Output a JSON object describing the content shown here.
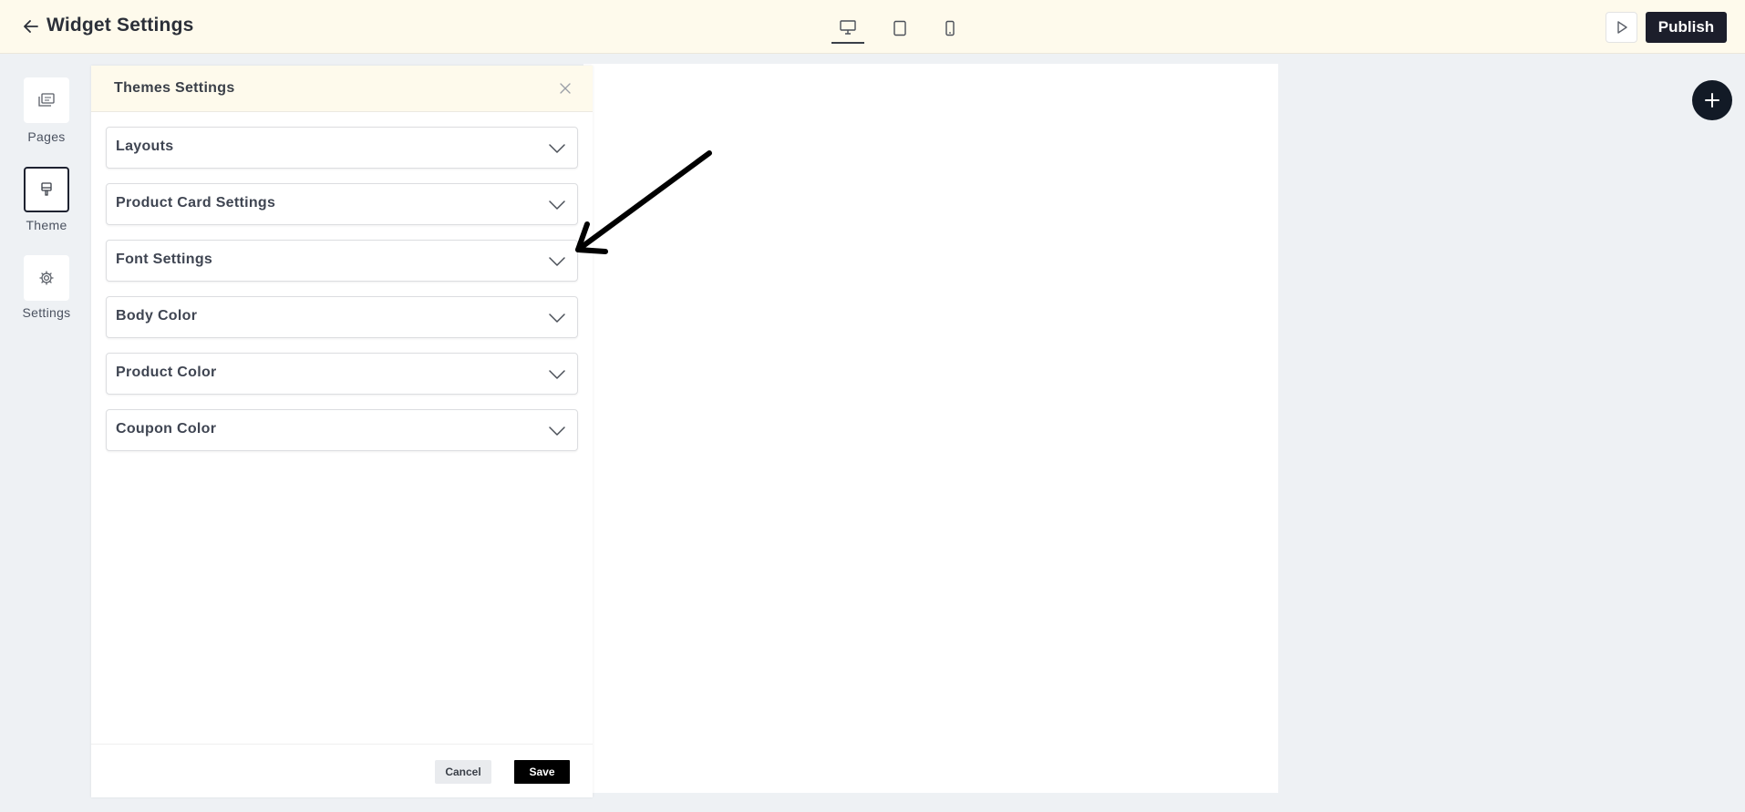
{
  "topbar": {
    "back_icon": "arrow-left-icon",
    "title": "Widget Settings",
    "devices": [
      {
        "name": "desktop",
        "icon": "monitor-icon",
        "active": true
      },
      {
        "name": "tablet",
        "icon": "tablet-icon",
        "active": false
      },
      {
        "name": "mobile",
        "icon": "mobile-icon",
        "active": false
      }
    ],
    "preview_icon": "play-icon",
    "publish_label": "Publish"
  },
  "sidebar": {
    "items": [
      {
        "label": "Pages",
        "icon": "pages-icon",
        "active": false
      },
      {
        "label": "Theme",
        "icon": "paint-brush-icon",
        "active": true
      },
      {
        "label": "Settings",
        "icon": "gear-icon",
        "active": false
      }
    ]
  },
  "panel": {
    "title": "Themes Settings",
    "close_icon": "close-icon",
    "sections": [
      {
        "label": "Layouts"
      },
      {
        "label": "Product Card Settings"
      },
      {
        "label": "Font Settings"
      },
      {
        "label": "Body Color"
      },
      {
        "label": "Product Color"
      },
      {
        "label": "Coupon Color"
      }
    ],
    "cancel_label": "Cancel",
    "save_label": "Save"
  },
  "fab": {
    "icon": "plus-icon"
  },
  "colors": {
    "topbar_bg": "#fefaec",
    "page_bg": "#eef1f4",
    "primary_dark": "#1c1e2b",
    "fab": "#121a26",
    "save": "#000000"
  }
}
